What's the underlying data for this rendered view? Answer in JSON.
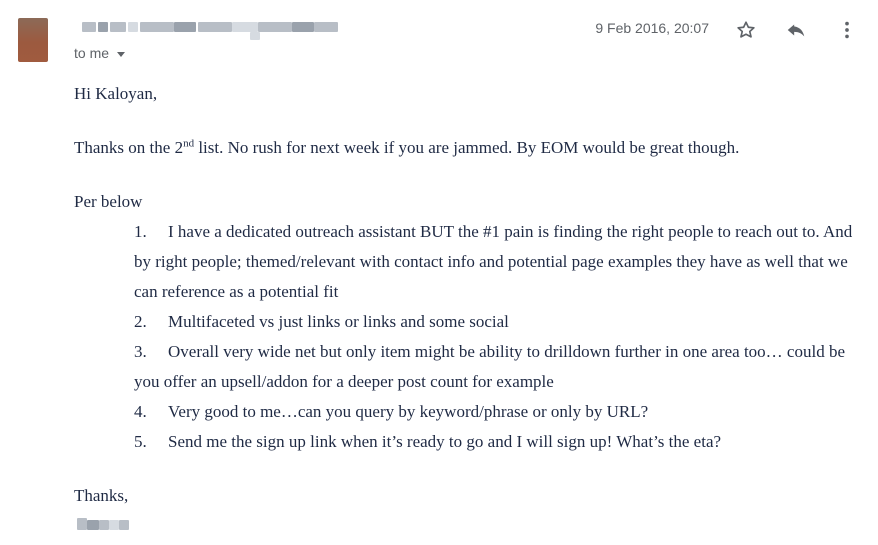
{
  "header": {
    "recipient_label": "to me",
    "date": "9 Feb 2016, 20:07"
  },
  "icons": {
    "star": "star-icon",
    "reply": "reply-icon",
    "more": "more-vertical-icon",
    "dropdown": "chevron-down-icon"
  },
  "message": {
    "greeting": "Hi Kaloyan,",
    "para1_pre": "Thanks on the 2",
    "para1_sup": "nd",
    "para1_post": " list. No rush for next week if you are jammed. By EOM would be great though.",
    "per_below": "Per below",
    "list": [
      {
        "num": "1.",
        "text": "I have a dedicated outreach assistant BUT the #1 pain is finding the right people to reach out to. And by right people; themed/relevant with contact info and potential page examples they have as well that we can reference as a potential fit"
      },
      {
        "num": "2.",
        "text": "Multifaceted vs just links or links and some social"
      },
      {
        "num": "3.",
        "text": "Overall very wide net but only item might be ability to drilldown further in one area too… could be you offer an upsell/addon for a deeper post count for example"
      },
      {
        "num": "4.",
        "text": "Very good to me…can you query by keyword/phrase or only by URL?"
      },
      {
        "num": "5.",
        "text": "Send me the sign up link when it’s ready to go and I will sign up! What’s the eta?"
      }
    ],
    "closing": "Thanks,"
  }
}
